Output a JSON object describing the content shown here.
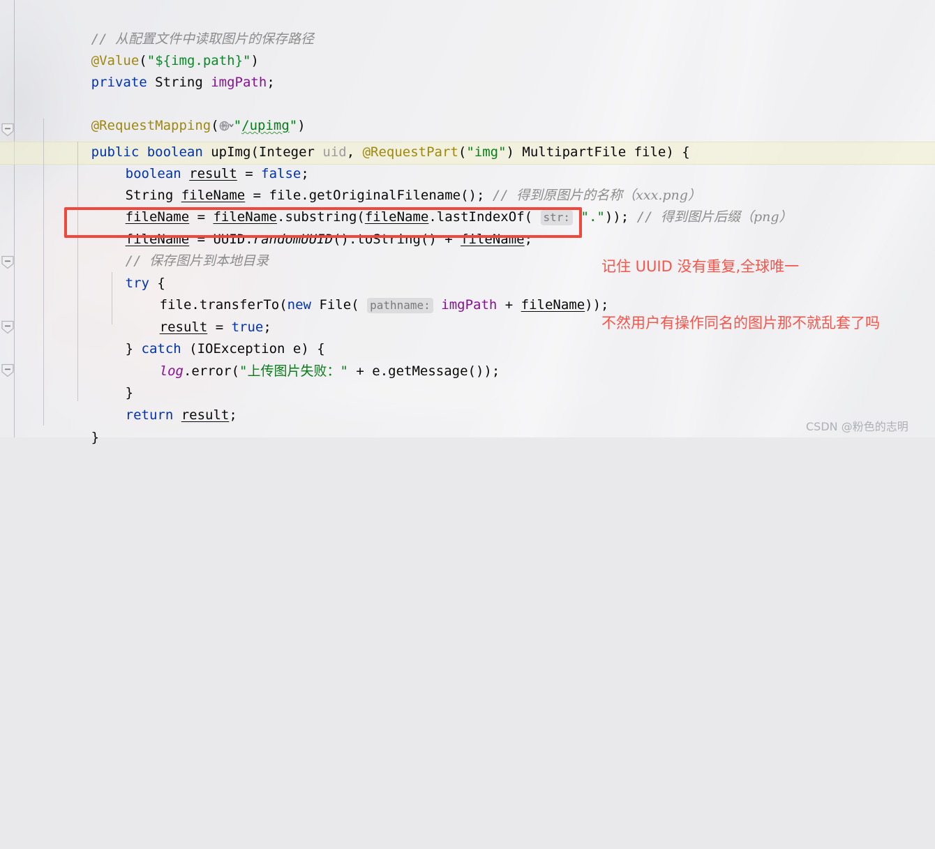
{
  "editor": {
    "language": "java",
    "background_theme": "light-with-image",
    "caret_line_color": "#f3f0cd",
    "gutter_fold_marker": "minus-fold-marker"
  },
  "code": {
    "lines": [
      {
        "id": "line-comment-path",
        "indent": 1,
        "text": "// 从配置文件中读取图片的保存路径",
        "tokens": [
          {
            "t": "// ",
            "c": "comment"
          },
          {
            "t": "从配置文件中读取图片的保存路径",
            "c": "comment-cjk"
          }
        ]
      },
      {
        "id": "line-value-annotation",
        "indent": 1,
        "text": "@Value(\"${img.path}\")",
        "tokens": [
          {
            "t": "@Value",
            "c": "annotation"
          },
          {
            "t": "(",
            "c": "punct"
          },
          {
            "t": "\"",
            "c": "string"
          },
          {
            "t": "${img.path}",
            "c": "string-template"
          },
          {
            "t": "\"",
            "c": "string"
          },
          {
            "t": ")",
            "c": "punct"
          }
        ]
      },
      {
        "id": "line-imgpath-field",
        "indent": 1,
        "text": "private String imgPath;",
        "tokens": [
          {
            "t": "private",
            "c": "keyword"
          },
          {
            "t": " String ",
            "c": "default"
          },
          {
            "t": "imgPath",
            "c": "field"
          },
          {
            "t": ";",
            "c": "punct"
          }
        ]
      },
      {
        "id": "line-blank-1",
        "indent": 0,
        "text": "",
        "tokens": []
      },
      {
        "id": "line-requestmapping",
        "indent": 1,
        "text": "@RequestMapping(\"/upimg\")",
        "gutter_icon": "globe-icon",
        "tokens": [
          {
            "t": "@RequestMapping",
            "c": "annotation"
          },
          {
            "t": "(",
            "c": "punct"
          },
          {
            "t": "globe-icon",
            "c": "icon"
          },
          {
            "t": "\"",
            "c": "string"
          },
          {
            "t": "/upimg",
            "c": "string-wavy"
          },
          {
            "t": "\"",
            "c": "string"
          },
          {
            "t": ")",
            "c": "punct"
          }
        ]
      },
      {
        "id": "line-method-signature",
        "indent": 1,
        "text": "public boolean upImg(Integer uid, @RequestPart(\"img\") MultipartFile file) {",
        "tokens": [
          {
            "t": "public boolean ",
            "c": "keyword"
          },
          {
            "t": "upImg",
            "c": "default"
          },
          {
            "t": "(Integer ",
            "c": "default"
          },
          {
            "t": "uid",
            "c": "gray"
          },
          {
            "t": ", ",
            "c": "punct"
          },
          {
            "t": "@RequestPart",
            "c": "annotation"
          },
          {
            "t": "(",
            "c": "punct"
          },
          {
            "t": "\"img\"",
            "c": "string"
          },
          {
            "t": ") MultipartFile file) {",
            "c": "default"
          }
        ]
      },
      {
        "id": "line-boolean-result",
        "indent": 2,
        "highlighted": true,
        "text": "boolean result = false;",
        "tokens": [
          {
            "t": "boolean",
            "c": "keyword"
          },
          {
            "t": " ",
            "c": "default"
          },
          {
            "t": "result",
            "c": "default-underline"
          },
          {
            "t": " = ",
            "c": "punct"
          },
          {
            "t": "false",
            "c": "keyword"
          },
          {
            "t": ";",
            "c": "punct"
          }
        ]
      },
      {
        "id": "line-get-original-filename",
        "indent": 2,
        "text": "String fileName = file.getOriginalFilename(); // 得到原图片的名称（xxx.png）",
        "tokens": [
          {
            "t": "String ",
            "c": "default"
          },
          {
            "t": "fileName",
            "c": "default-underline"
          },
          {
            "t": " = file.getOriginalFilename(); ",
            "c": "default"
          },
          {
            "t": "// ",
            "c": "comment"
          },
          {
            "t": "得到原图片的名称（xxx.png）",
            "c": "comment-cjk"
          }
        ]
      },
      {
        "id": "line-substring-suffix",
        "indent": 2,
        "text": "fileName = fileName.substring(fileName.lastIndexOf( str: \".\")); // 得到图片后缀（png）",
        "tokens": [
          {
            "t": "fileName",
            "c": "default-underline"
          },
          {
            "t": " = ",
            "c": "punct"
          },
          {
            "t": "fileName",
            "c": "default-underline"
          },
          {
            "t": ".substring(",
            "c": "default"
          },
          {
            "t": "fileName",
            "c": "default-underline"
          },
          {
            "t": ".lastIndexOf(",
            "c": "default"
          },
          {
            "t": "str:",
            "c": "param-hint"
          },
          {
            "t": "\".\"",
            "c": "string"
          },
          {
            "t": ")); ",
            "c": "default"
          },
          {
            "t": "// ",
            "c": "comment"
          },
          {
            "t": "得到图片后缀（png）",
            "c": "comment-cjk"
          }
        ]
      },
      {
        "id": "line-uuid-filename",
        "indent": 2,
        "boxed": true,
        "text": "fileName = UUID.randomUUID().toString() + fileName;",
        "tokens": [
          {
            "t": "fileName",
            "c": "default-underline"
          },
          {
            "t": " = UUID.",
            "c": "default"
          },
          {
            "t": "randomUUID",
            "c": "static-italic"
          },
          {
            "t": "().toString() + ",
            "c": "default"
          },
          {
            "t": "fileName",
            "c": "default-underline"
          },
          {
            "t": ";",
            "c": "punct"
          }
        ]
      },
      {
        "id": "line-comment-save",
        "indent": 2,
        "text": "// 保存图片到本地目录",
        "tokens": [
          {
            "t": "// ",
            "c": "comment"
          },
          {
            "t": "保存图片到本地目录",
            "c": "comment-cjk"
          }
        ]
      },
      {
        "id": "line-try",
        "indent": 2,
        "text": "try {",
        "tokens": [
          {
            "t": "try",
            "c": "keyword"
          },
          {
            "t": " {",
            "c": "punct"
          }
        ]
      },
      {
        "id": "line-transferto",
        "indent": 3,
        "text": "file.transferTo(new File( pathname: imgPath + fileName));",
        "tokens": [
          {
            "t": "file.transferTo(",
            "c": "default"
          },
          {
            "t": "new",
            "c": "keyword"
          },
          {
            "t": " File(",
            "c": "default"
          },
          {
            "t": "pathname:",
            "c": "param-hint"
          },
          {
            "t": "imgPath",
            "c": "field"
          },
          {
            "t": " + ",
            "c": "punct"
          },
          {
            "t": "fileName",
            "c": "default-underline"
          },
          {
            "t": "));",
            "c": "punct"
          }
        ]
      },
      {
        "id": "line-result-true",
        "indent": 3,
        "text": "result = true;",
        "tokens": [
          {
            "t": "result",
            "c": "default-underline"
          },
          {
            "t": " = ",
            "c": "punct"
          },
          {
            "t": "true",
            "c": "keyword"
          },
          {
            "t": ";",
            "c": "punct"
          }
        ]
      },
      {
        "id": "line-catch",
        "indent": 2,
        "text": "} catch (IOException e) {",
        "tokens": [
          {
            "t": "} ",
            "c": "punct"
          },
          {
            "t": "catch",
            "c": "keyword"
          },
          {
            "t": " (IOException e) {",
            "c": "default"
          }
        ]
      },
      {
        "id": "line-log-error",
        "indent": 3,
        "text": "log.error(\"上传图片失败：\" + e.getMessage());",
        "tokens": [
          {
            "t": "log",
            "c": "field-italic"
          },
          {
            "t": ".error(",
            "c": "default"
          },
          {
            "t": "\"上传图片失败：\"",
            "c": "string"
          },
          {
            "t": " + ",
            "c": "punct"
          },
          {
            "t": "e.getMessage());",
            "c": "default"
          }
        ]
      },
      {
        "id": "line-close-catch",
        "indent": 2,
        "text": "}",
        "tokens": [
          {
            "t": "}",
            "c": "punct"
          }
        ]
      },
      {
        "id": "line-return-result",
        "indent": 2,
        "text": "return result;",
        "tokens": [
          {
            "t": "return",
            "c": "keyword"
          },
          {
            "t": " ",
            "c": "default"
          },
          {
            "t": "result",
            "c": "default-underline"
          },
          {
            "t": ";",
            "c": "punct"
          }
        ]
      },
      {
        "id": "line-close-method",
        "indent": 1,
        "text": "}",
        "tokens": [
          {
            "t": "}",
            "c": "punct"
          }
        ]
      }
    ]
  },
  "annotation": {
    "box_color": "#f0483c",
    "note_color": "#f7544a",
    "note_line_1": "记住 UUID 没有重复,全球唯一",
    "note_line_2": "不然用户有操作同名的图片那不就乱套了吗"
  },
  "watermark": {
    "text": "CSDN @粉色的志明"
  }
}
